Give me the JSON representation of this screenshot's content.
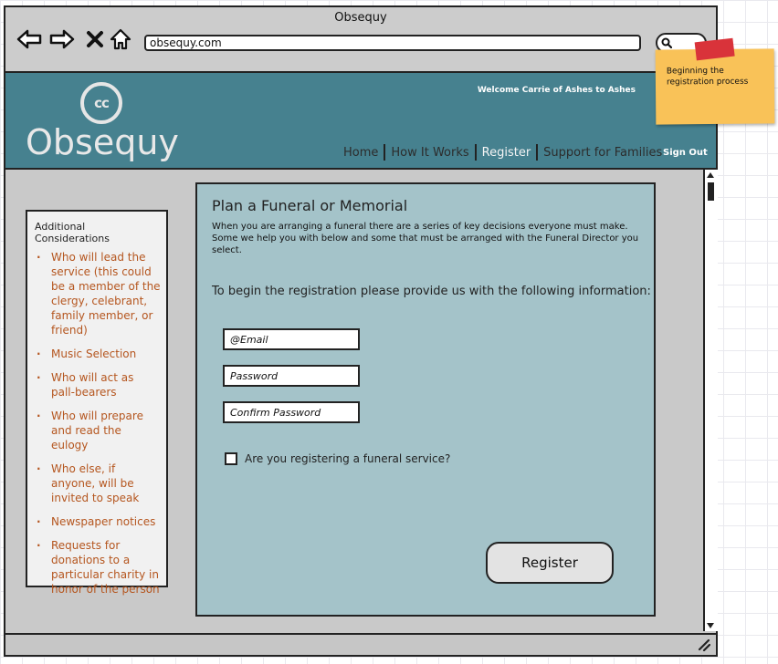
{
  "window": {
    "title": "Obsequy"
  },
  "browser": {
    "url": "obsequy.com",
    "icons": {
      "back": "arrow-left-icon",
      "forward": "arrow-right-icon",
      "stop": "close-icon",
      "home": "home-icon",
      "search": "search-icon"
    }
  },
  "header": {
    "logo_mark": "cc",
    "logo_text": "Obsequy",
    "welcome": "Welcome Carrie of Ashes to Ashes",
    "nav": [
      {
        "label": "Home"
      },
      {
        "label": "How It Works"
      },
      {
        "label": "Register"
      },
      {
        "label": "Support for Families"
      }
    ],
    "sign_out": "Sign Out"
  },
  "sidebar": {
    "title": "Additional Considerations",
    "items": [
      "Who will lead the service (this could be a member of the clergy, celebrant, family member, or friend)",
      "Music Selection",
      "Who will act as pall-bearers",
      "Who will prepare and read the eulogy",
      "Who else, if anyone, will be invited to speak",
      "Newspaper notices",
      "Requests for donations to a particular charity in honor of the person"
    ]
  },
  "main": {
    "title": "Plan a Funeral or Memorial",
    "intro": "When you are arranging a funeral there are a series of key decisions everyone must make. Some we help you with below and some that must be arranged with the Funeral Director you select.",
    "prompt": "To begin the registration please provide us with the following information:",
    "fields": {
      "email_placeholder": "@Email",
      "password_placeholder": "Password",
      "confirm_placeholder": "Confirm Password"
    },
    "checkbox_label": "Are you registering a funeral service?",
    "register_label": "Register"
  },
  "sticky_note": {
    "text": "Beginning the registration process"
  },
  "colors": {
    "header_bg": "#46818f",
    "panel_bg": "#a4c3c9",
    "sidebar_link": "#b5561f",
    "sticky": "#f9c258",
    "tape": "#d9333a"
  }
}
